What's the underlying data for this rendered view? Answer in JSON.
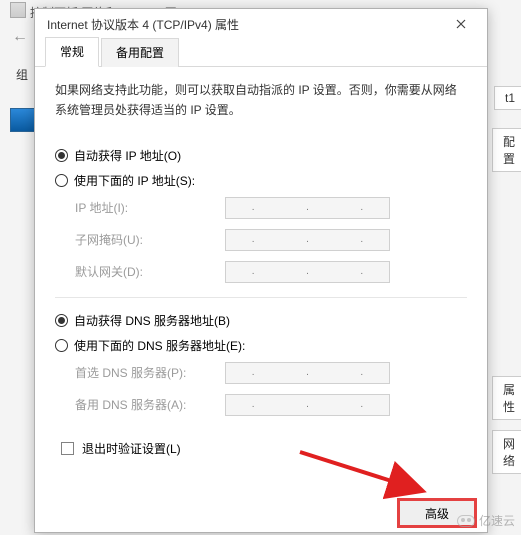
{
  "background": {
    "path_title": "控制面板\\网络和 Internet\\网…",
    "back_arrow": "←",
    "organize_label": "组",
    "right_fragments": {
      "t1": "t1",
      "properties": "属性",
      "network": "网络",
      "config": "配置"
    }
  },
  "dialog": {
    "title": "Internet 协议版本 4 (TCP/IPv4) 属性",
    "tabs": {
      "general": "常规",
      "alternate": "备用配置"
    },
    "description": "如果网络支持此功能，则可以获取自动指派的 IP 设置。否则，你需要从网络系统管理员处获得适当的 IP 设置。",
    "ip_group": {
      "auto_label": "自动获得 IP 地址(O)",
      "manual_label": "使用下面的 IP 地址(S):",
      "fields": {
        "ip": "IP 地址(I):",
        "mask": "子网掩码(U):",
        "gateway": "默认网关(D):"
      }
    },
    "dns_group": {
      "auto_label": "自动获得 DNS 服务器地址(B)",
      "manual_label": "使用下面的 DNS 服务器地址(E):",
      "fields": {
        "preferred": "首选 DNS 服务器(P):",
        "alternate": "备用 DNS 服务器(A):"
      }
    },
    "validate_label": "退出时验证设置(L)",
    "advanced_label": "高级"
  },
  "watermark": {
    "text": "亿速云"
  }
}
